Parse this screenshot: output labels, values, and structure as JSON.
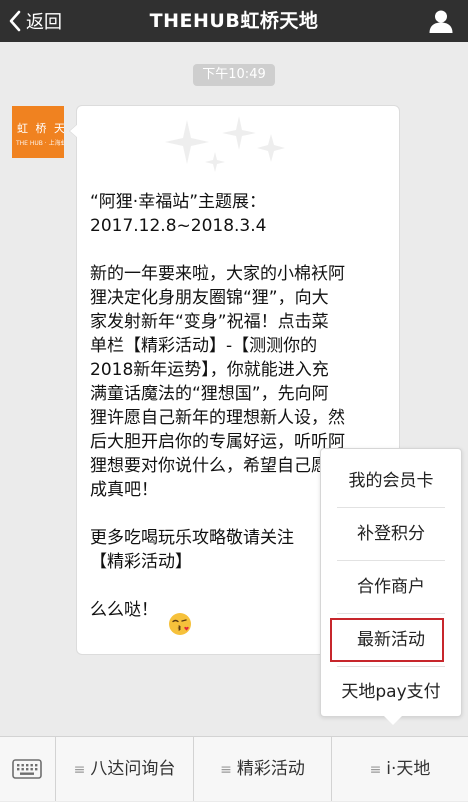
{
  "header": {
    "back_label": "返回",
    "title": "THEHUB虹桥天地"
  },
  "chat": {
    "timestamp": "下午10:49",
    "avatar_text": "虹 桥 天 地",
    "avatar_subtext": "THE HUB · 上海虹桥天地",
    "message_text": "“阿狸·幸福站”主题展：\n2017.12.8~2018.3.4\n\n新的一年要来啦，大家的小棉袄阿\n狸决定化身朋友圈锦“狸”，向大\n家发射新年“变身”祝福！点击菜\n单栏【精彩活动】-【测测你的\n2018新年运势】，你就能进入充\n满童话魔法的“狸想国”，先向阿\n狸许愿自己新年的理想新人设，然\n后大胆开启你的专属好运，听听阿\n狸想要对你说什么，希望自己愿望\n成真吧！\n\n更多吃喝玩乐攻略敬请关注\n【精彩活动】\n\n么么哒！"
  },
  "popup_menu": {
    "items": [
      "我的会员卡",
      "补登积分",
      "合作商户",
      "最新活动",
      "天地pay支付"
    ],
    "highlighted": "最新活动",
    "highlight_color": "#c7262c"
  },
  "bottom_bar": {
    "tabs": [
      "八达问询台",
      "精彩活动",
      "i·天地"
    ]
  },
  "colors": {
    "header_bg": "#303030",
    "chat_bg": "#ebebeb",
    "avatar_bg": "#f08220"
  },
  "icons": {
    "back": "chevron-left-icon",
    "profile": "person-icon",
    "keyboard": "keyboard-icon",
    "menu": "hamburger-icon",
    "emoji": "kiss-emoji-icon"
  }
}
